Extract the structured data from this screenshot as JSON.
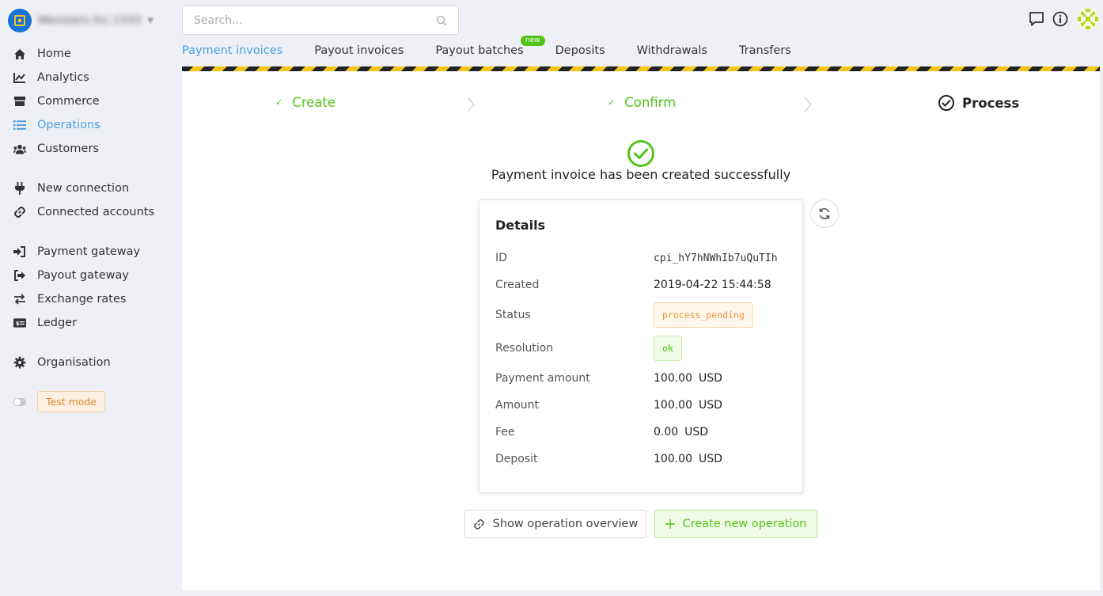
{
  "org": {
    "name": "Wonsters Inc.1333"
  },
  "search": {
    "placeholder": "Search..."
  },
  "sidebar": {
    "items": [
      {
        "label": "Home",
        "icon": "home-icon"
      },
      {
        "label": "Analytics",
        "icon": "chart-line-icon"
      },
      {
        "label": "Commerce",
        "icon": "store-icon"
      },
      {
        "label": "Operations",
        "icon": "list-icon",
        "active": true
      },
      {
        "label": "Customers",
        "icon": "users-icon"
      },
      {
        "label": "New connection",
        "icon": "plug-icon"
      },
      {
        "label": "Connected accounts",
        "icon": "link-icon"
      },
      {
        "label": "Payment gateway",
        "icon": "sign-in-icon"
      },
      {
        "label": "Payout gateway",
        "icon": "sign-out-icon"
      },
      {
        "label": "Exchange rates",
        "icon": "exchange-icon"
      },
      {
        "label": "Ledger",
        "icon": "money-bill-icon"
      },
      {
        "label": "Organisation",
        "icon": "gear-icon"
      }
    ],
    "test_mode": "Test mode"
  },
  "tabs": [
    {
      "label": "Payment invoices",
      "active": true
    },
    {
      "label": "Payout invoices"
    },
    {
      "label": "Payout batches",
      "badge": "new"
    },
    {
      "label": "Deposits"
    },
    {
      "label": "Withdrawals"
    },
    {
      "label": "Transfers"
    }
  ],
  "steps": [
    {
      "label": "Create",
      "state": "done"
    },
    {
      "label": "Confirm",
      "state": "done"
    },
    {
      "label": "Process",
      "state": "current"
    }
  ],
  "success_message": "Payment invoice has been created successfully",
  "details": {
    "title": "Details",
    "id_label": "ID",
    "id_value": "cpi_hY7hNWhIb7uQuTIh",
    "created_label": "Created",
    "created_value": "2019-04-22 15:44:58",
    "status_label": "Status",
    "status_value": "process_pending",
    "resolution_label": "Resolution",
    "resolution_value": "ok",
    "payment_amount_label": "Payment amount",
    "payment_amount_value": "100.00",
    "payment_amount_currency": "USD",
    "amount_label": "Amount",
    "amount_value": "100.00",
    "amount_currency": "USD",
    "fee_label": "Fee",
    "fee_value": "0.00",
    "fee_currency": "USD",
    "deposit_label": "Deposit",
    "deposit_value": "100.00",
    "deposit_currency": "USD"
  },
  "actions": {
    "overview_label": "Show operation overview",
    "create_label": "Create new operation"
  },
  "colors": {
    "accent": "#4a9de0",
    "success": "#52c41a",
    "warning": "#e8963a"
  }
}
